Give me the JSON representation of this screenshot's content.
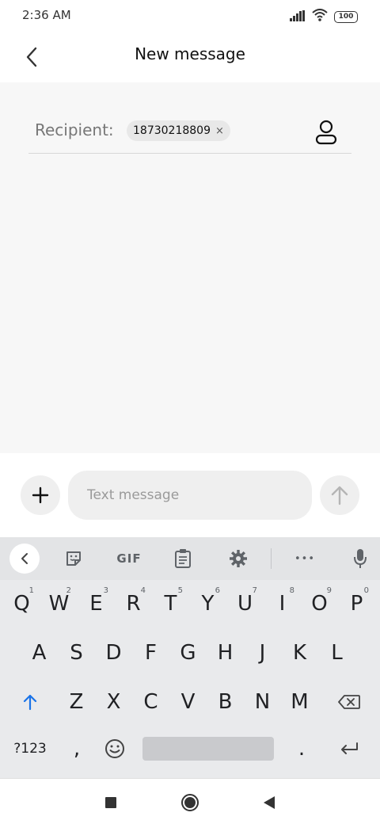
{
  "status_bar": {
    "time": "2:36 AM",
    "battery": "100"
  },
  "header": {
    "title": "New message"
  },
  "recipient": {
    "label": "Recipient:",
    "chip_value": "18730218809",
    "chip_close": "×"
  },
  "input_bar": {
    "placeholder": "Text message"
  },
  "keyboard": {
    "toolbar": {
      "gif": "GIF",
      "more": "•••"
    },
    "row1": [
      {
        "k": "Q",
        "h": "1"
      },
      {
        "k": "W",
        "h": "2"
      },
      {
        "k": "E",
        "h": "3"
      },
      {
        "k": "R",
        "h": "4"
      },
      {
        "k": "T",
        "h": "5"
      },
      {
        "k": "Y",
        "h": "6"
      },
      {
        "k": "U",
        "h": "7"
      },
      {
        "k": "I",
        "h": "8"
      },
      {
        "k": "O",
        "h": "9"
      },
      {
        "k": "P",
        "h": "0"
      }
    ],
    "row2": [
      "A",
      "S",
      "D",
      "F",
      "G",
      "H",
      "J",
      "K",
      "L"
    ],
    "row3": [
      "Z",
      "X",
      "C",
      "V",
      "B",
      "N",
      "M"
    ],
    "symbols_label": "?123",
    "comma": ",",
    "period": "."
  },
  "colors": {
    "shift_accent": "#1a73e8",
    "background": "#f7f7f7"
  }
}
